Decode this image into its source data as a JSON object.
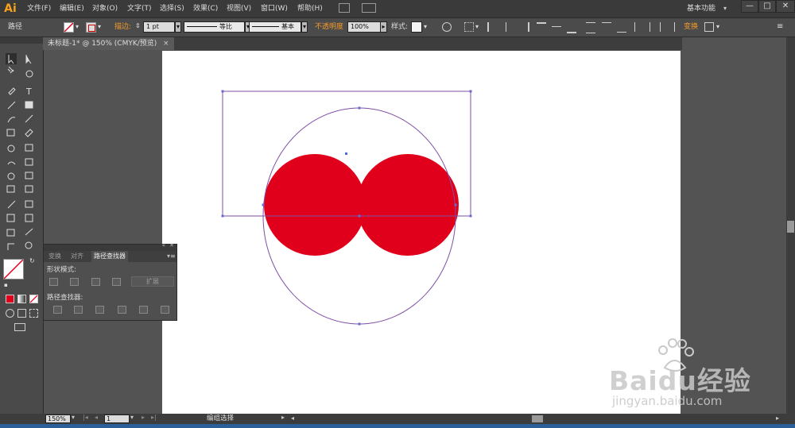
{
  "app": {
    "logo": "Ai"
  },
  "menu": [
    "文件(F)",
    "编辑(E)",
    "对象(O)",
    "文字(T)",
    "选择(S)",
    "效果(C)",
    "视图(V)",
    "窗口(W)",
    "帮助(H)"
  ],
  "workspace": {
    "label": "基本功能"
  },
  "window_buttons": [
    "—",
    "□",
    "✕"
  ],
  "control_bar": {
    "selection_label": "路径",
    "stroke_label": "描边:",
    "stroke_weight": "1 pt",
    "stroke_profile": "等比",
    "brush": "基本",
    "opacity_label": "不透明度",
    "opacity_value": "100%",
    "style_label": "样式:",
    "transform_label": "变换"
  },
  "document": {
    "tab_title": "未标题-1* @ 150% (CMYK/预览)",
    "close": "×"
  },
  "pathfinder_panel": {
    "tabs": [
      {
        "label": "变换"
      },
      {
        "label": "对齐"
      },
      {
        "label": "路径查找器"
      }
    ],
    "shape_modes_label": "形状模式:",
    "expand_label": "扩展",
    "pathfinders_label": "路径查找器:"
  },
  "status_bar": {
    "zoom": "150%",
    "page": "1",
    "status_text": "编组选择"
  },
  "artwork": {
    "fill_color": "#e0001b",
    "selection_color": "#7f4fa5"
  },
  "watermark": {
    "brand": "Baidu经验",
    "url": "jingyan.baidu.com"
  }
}
